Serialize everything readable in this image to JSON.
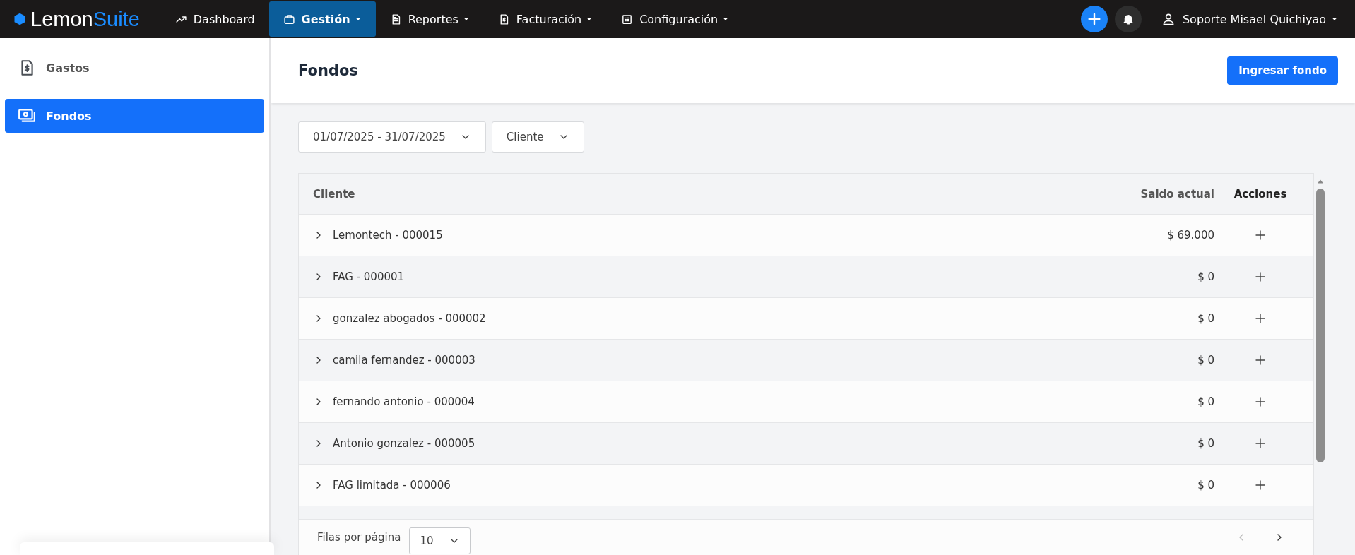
{
  "navbar": {
    "logo": {
      "part_1": "Lemon",
      "part_2": "Suite"
    },
    "menu": [
      {
        "label": "Dashboard",
        "dropdown": false,
        "selected": false
      },
      {
        "label": "Gestión",
        "dropdown": true,
        "selected": true
      },
      {
        "label": "Reportes",
        "dropdown": true,
        "selected": false
      },
      {
        "label": "Facturación",
        "dropdown": true,
        "selected": false
      },
      {
        "label": "Configuración",
        "dropdown": true,
        "selected": false
      }
    ],
    "user": {
      "name": "Soporte Misael Quichiyao"
    }
  },
  "sidebar": {
    "items": [
      {
        "label": "Gastos",
        "selected": false
      },
      {
        "label": "Fondos",
        "selected": true
      }
    ]
  },
  "page": {
    "title": "Fondos",
    "primary_button": "Ingresar fondo"
  },
  "filters": [
    {
      "value": "01/07/2025 - 31/07/2025"
    },
    {
      "value": "Cliente"
    }
  ],
  "table": {
    "columns": [
      {
        "label": "Cliente"
      },
      {
        "label": "Saldo actual"
      },
      {
        "label": "Acciones"
      }
    ],
    "rows": [
      {
        "client": "Lemontech - 000015",
        "balance": "$ 69.000"
      },
      {
        "client": "FAG - 000001",
        "balance": "$ 0"
      },
      {
        "client": "gonzalez abogados - 000002",
        "balance": "$ 0"
      },
      {
        "client": "camila fernandez - 000003",
        "balance": "$ 0"
      },
      {
        "client": "fernando antonio - 000004",
        "balance": "$ 0"
      },
      {
        "client": "Antonio gonzalez - 000005",
        "balance": "$ 0"
      },
      {
        "client": "FAG limitada - 000006",
        "balance": "$ 0"
      }
    ]
  },
  "pagination": {
    "label": "Filas por página",
    "page_size": "10",
    "prev_disabled": true,
    "next_disabled": false
  }
}
